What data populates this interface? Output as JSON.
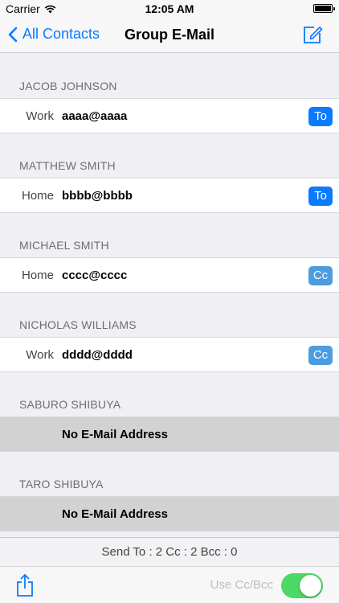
{
  "status_bar": {
    "carrier": "Carrier",
    "time": "12:05 AM"
  },
  "nav": {
    "back_label": "All Contacts",
    "title": "Group E-Mail"
  },
  "contacts": [
    {
      "name": "JACOB JOHNSON",
      "label": "Work",
      "email": "aaaa@aaaa",
      "button": "To"
    },
    {
      "name": "MATTHEW SMITH",
      "label": "Home",
      "email": "bbbb@bbbb",
      "button": "To"
    },
    {
      "name": "MICHAEL SMITH",
      "label": "Home",
      "email": "cccc@cccc",
      "button": "Cc"
    },
    {
      "name": "NICHOLAS WILLIAMS",
      "label": "Work",
      "email": "dddd@dddd",
      "button": "Cc"
    },
    {
      "name": "SABURO SHIBUYA",
      "label": "",
      "email": "No E-Mail Address",
      "button": ""
    },
    {
      "name": "TARO SHIBUYA",
      "label": "",
      "email": "No E-Mail Address",
      "button": ""
    }
  ],
  "summary": "Send To : 2  Cc : 2  Bcc : 0",
  "toolbar": {
    "use_cc_bcc_label": "Use Cc/Bcc",
    "use_cc_bcc_on": true
  },
  "colors": {
    "accent": "#0a7aff",
    "to_button": "#0a7aff",
    "cc_button": "#4c9ce0",
    "switch_on": "#4cd964"
  }
}
